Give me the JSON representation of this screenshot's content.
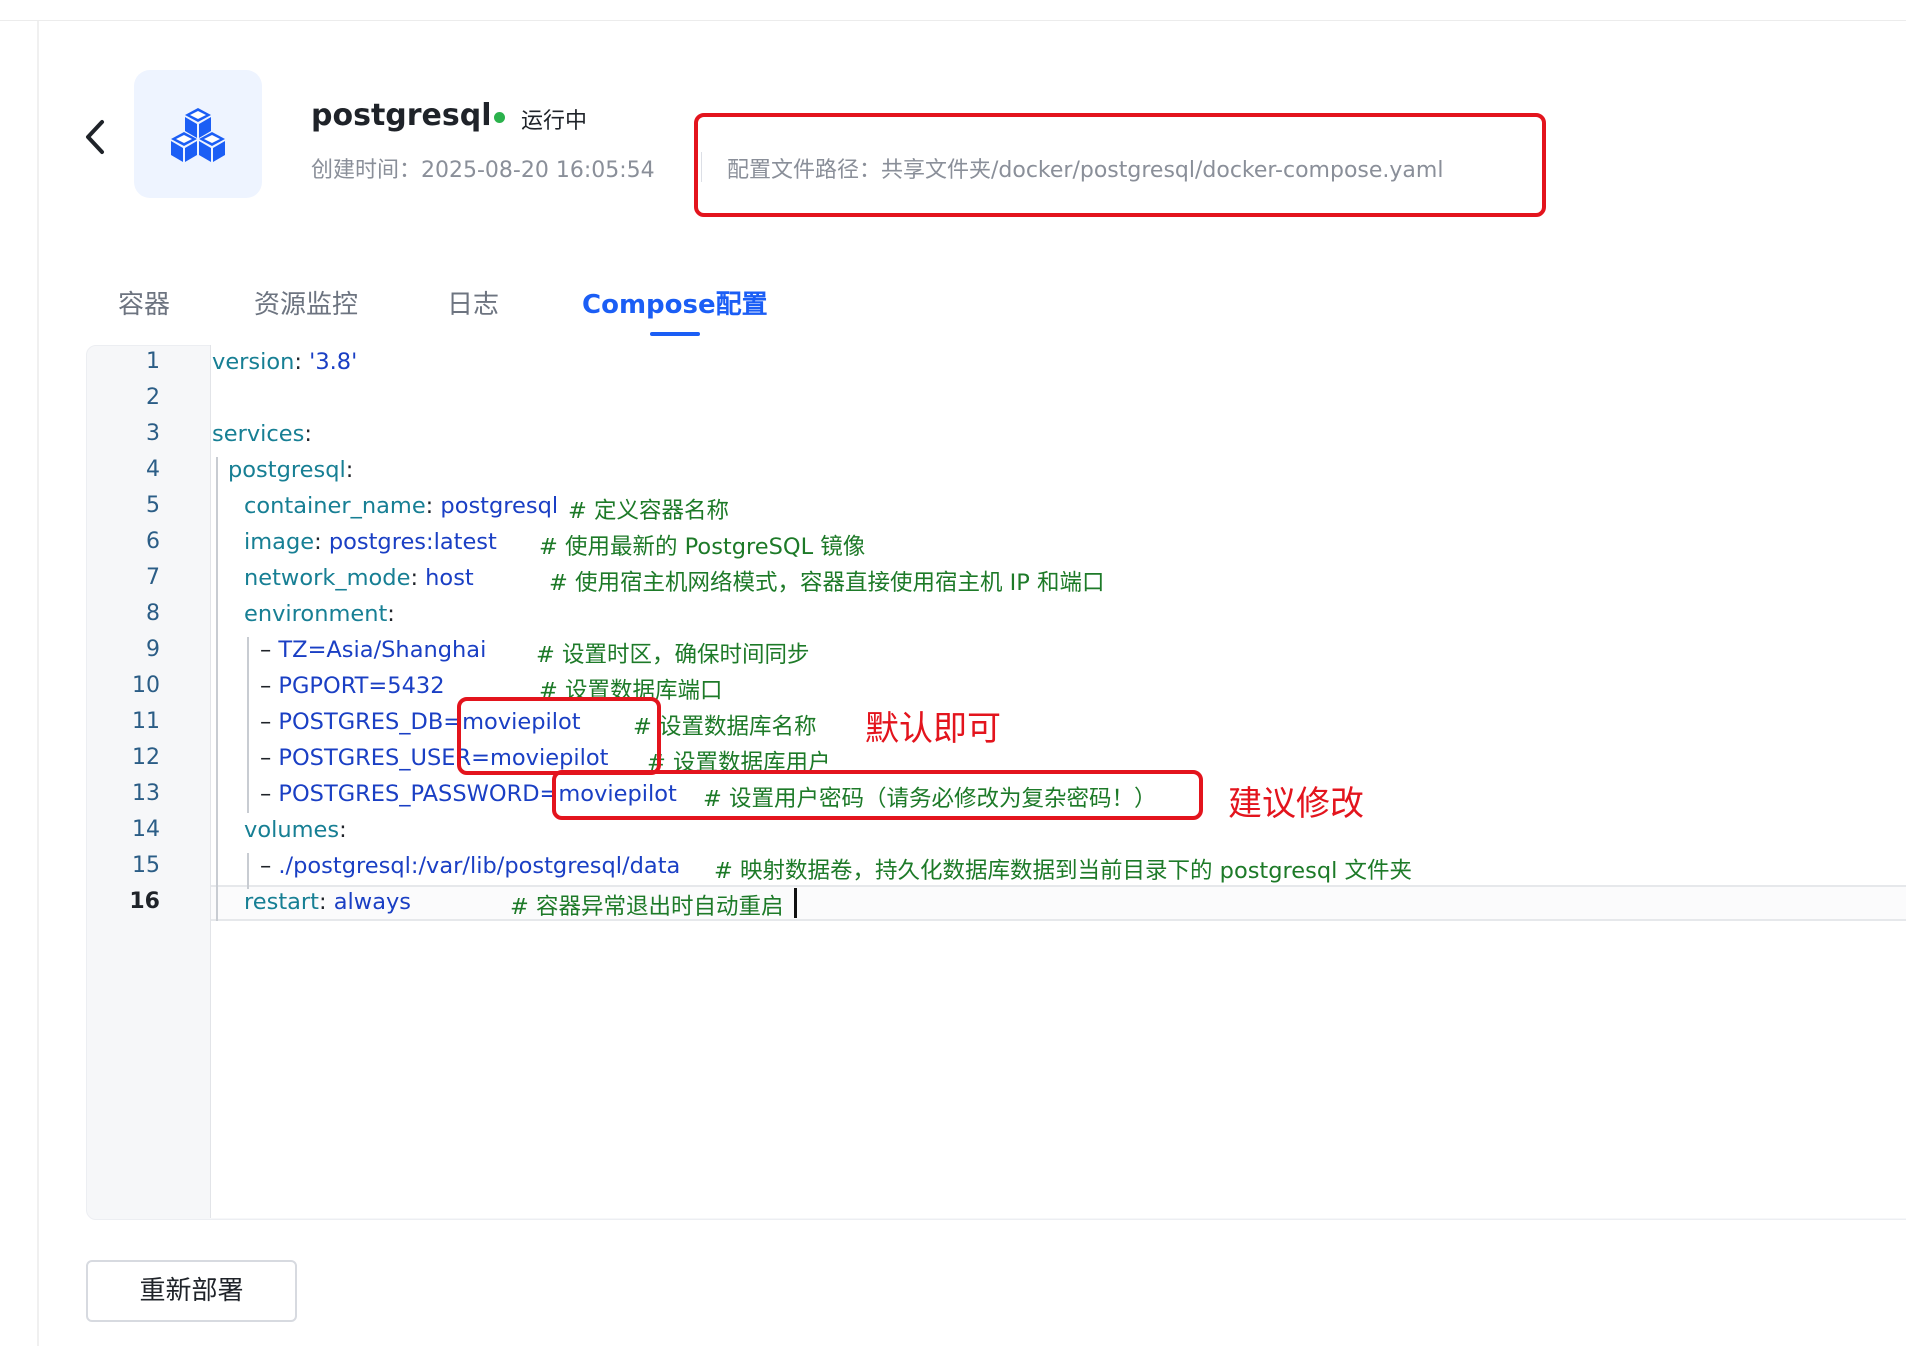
{
  "app": {
    "name": "postgresql",
    "status": "运行中",
    "created": "创建时间：2025-08-20 16:05:54",
    "config_path": "配置文件路径：共享文件夹/docker/postgresql/docker-compose.yaml",
    "icon": "cubes-icon",
    "status_color": "#2bb24c"
  },
  "tabs": [
    {
      "label": "容器",
      "active": false
    },
    {
      "label": "资源监控",
      "active": false
    },
    {
      "label": "日志",
      "active": false
    },
    {
      "label": "Compose配置",
      "active": true
    }
  ],
  "editor": {
    "line_numbers": [
      "1",
      "2",
      "3",
      "4",
      "5",
      "6",
      "7",
      "8",
      "9",
      "10",
      "11",
      "12",
      "13",
      "14",
      "15",
      "16"
    ],
    "current_line": "16",
    "lines": [
      {
        "key": "version",
        "sep": ": ",
        "value": "'3.8'",
        "comment": ""
      },
      {
        "key": "",
        "sep": "",
        "value": "",
        "comment": ""
      },
      {
        "key": "services",
        "sep": ":",
        "value": "",
        "comment": ""
      },
      {
        "key": "postgresql",
        "sep": ":",
        "value": "",
        "comment": ""
      },
      {
        "key": "container_name",
        "sep": ": ",
        "value": "postgresql",
        "comment": "# 定义容器名称"
      },
      {
        "key": "image",
        "sep": ": ",
        "value": "postgres:latest",
        "comment": "# 使用最新的 PostgreSQL 镜像"
      },
      {
        "key": "network_mode",
        "sep": ": ",
        "value": "host",
        "comment": "# 使用宿主机网络模式，容器直接使用宿主机 IP 和端口"
      },
      {
        "key": "environment",
        "sep": ":",
        "value": "",
        "comment": ""
      },
      {
        "dash": "–",
        "value": "TZ=Asia/Shanghai",
        "comment": "# 设置时区，确保时间同步"
      },
      {
        "dash": "–",
        "value": "PGPORT=5432",
        "comment": "# 设置数据库端口"
      },
      {
        "dash": "–",
        "value": "POSTGRES_DB=moviepilot",
        "comment": "# 设置数据库名称"
      },
      {
        "dash": "–",
        "value": "POSTGRES_USER=moviepilot",
        "comment": "# 设置数据库用户"
      },
      {
        "dash": "–",
        "value": "POSTGRES_PASSWORD=moviepilot",
        "comment": "# 设置用户密码（请务必修改为复杂密码！）"
      },
      {
        "key": "volumes",
        "sep": ":",
        "value": "",
        "comment": ""
      },
      {
        "dash": "–",
        "value": "./postgresql:/var/lib/postgresql/data",
        "comment": "# 映射数据卷，持久化数据库数据到当前目录下的 postgresql 文件夹"
      },
      {
        "key": "restart",
        "sep": ": ",
        "value": "always",
        "comment": "# 容器异常退出时自动重启"
      }
    ]
  },
  "annotations": {
    "default_ok": "默认即可",
    "suggest_modify": "建议修改",
    "color": "#e3141d"
  },
  "footer": {
    "redeploy_label": "重新部署"
  }
}
